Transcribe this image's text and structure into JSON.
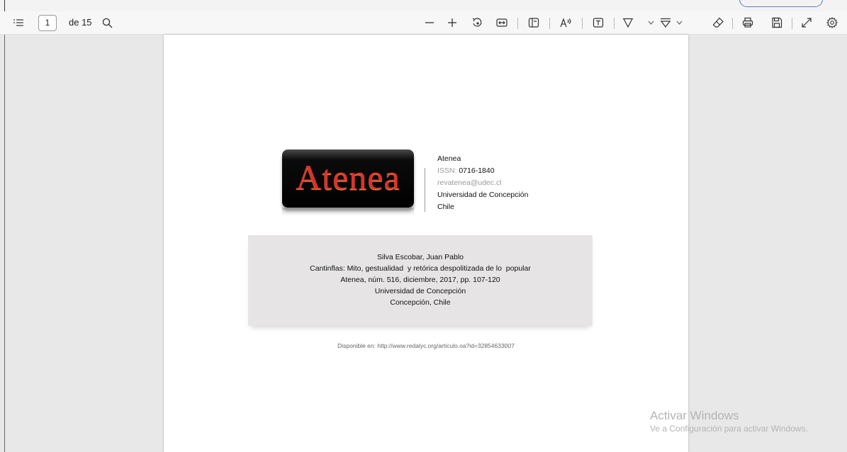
{
  "toolbar": {
    "page_current": "1",
    "page_total": "de 15",
    "icons": [
      "contents-icon",
      "search-icon",
      "zoom-out-icon",
      "zoom-in-icon",
      "rotate-icon",
      "fit-width-icon",
      "page-view-icon",
      "read-aloud-icon",
      "text-icon",
      "draw-icon",
      "chevron-down-icon",
      "highlight-icon",
      "chevron-down-icon",
      "eraser-icon",
      "print-icon",
      "save-icon",
      "fullscreen-icon",
      "settings-icon"
    ]
  },
  "document": {
    "logo_text": "Atenea",
    "journal": {
      "name": "Atenea",
      "issn_label": "ISSN: ",
      "issn_value": "0716-1840",
      "email": "revatenea@udec.cl",
      "institution": "Universidad de Concepción",
      "country": "Chile"
    },
    "citation": {
      "author": "Silva Escobar, Juan Pablo",
      "title": "Cantinflas: Mito, gestualidad  y retórica despolitizada de lo  popular",
      "source": "Atenea, núm. 516, diciembre, 2017, pp. 107-120",
      "publisher": "Universidad de Concepción",
      "location": "Concepción, Chile"
    },
    "available": "Disponible en: http://www.redalyc.org/articulo.oa?id=32854633007"
  },
  "watermark": {
    "line1": "Activar Windows",
    "line2": "Ve a Configuración para activar Windows."
  }
}
